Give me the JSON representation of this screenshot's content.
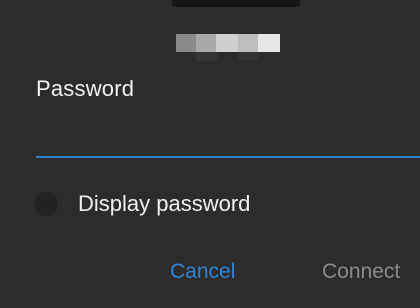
{
  "dialog": {
    "password_label": "Password",
    "password_value": "",
    "show_password_label": "Display password",
    "cancel_label": "Cancel",
    "connect_label": "Connect"
  },
  "colors": {
    "background": "#2c2c2c",
    "accent": "#2f84d8",
    "disabled_text": "#8a8a8a"
  }
}
